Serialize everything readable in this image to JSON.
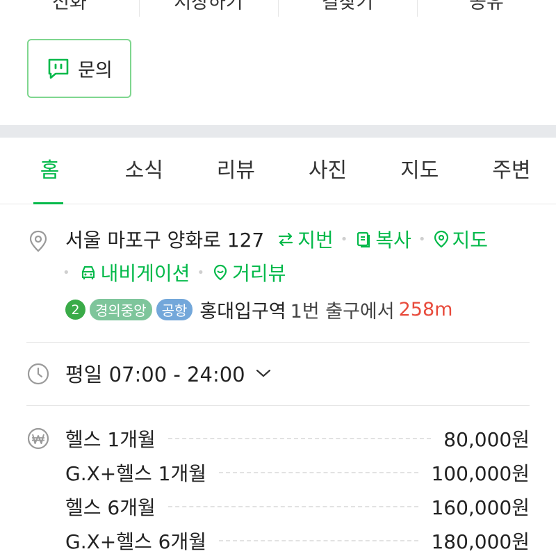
{
  "actions": [
    "전화",
    "저장하기",
    "길찾기",
    "공유"
  ],
  "inquiry": {
    "label": "문의",
    "icon": "chat-icon"
  },
  "tabs": [
    {
      "label": "홈",
      "active": true
    },
    {
      "label": "소식"
    },
    {
      "label": "리뷰"
    },
    {
      "label": "사진"
    },
    {
      "label": "지도"
    },
    {
      "label": "주변"
    }
  ],
  "address": {
    "text": "서울 마포구 양화로 127",
    "links": {
      "jibun": "지번",
      "copy": "복사",
      "map": "지도",
      "navigation": "내비게이션",
      "streetview": "거리뷰"
    }
  },
  "subway": {
    "line_number": "2",
    "badges": [
      "경의중앙",
      "공항"
    ],
    "station": "홍대입구역",
    "exit": "1번 출구에서",
    "distance": "258m"
  },
  "hours": {
    "text": "평일 07:00 - 24:00"
  },
  "prices": [
    {
      "name": "헬스 1개월",
      "price": "80,000원"
    },
    {
      "name": "G.X+헬스 1개월",
      "price": "100,000원"
    },
    {
      "name": "헬스 6개월",
      "price": "160,000원"
    },
    {
      "name": "G.X+헬스 6개월",
      "price": "180,000원"
    }
  ],
  "colors": {
    "accent": "#03b94a",
    "distance": "#e84b3c",
    "line2": "#3aab48",
    "gyeongui": "#7ec59b",
    "airport": "#73a7da"
  }
}
